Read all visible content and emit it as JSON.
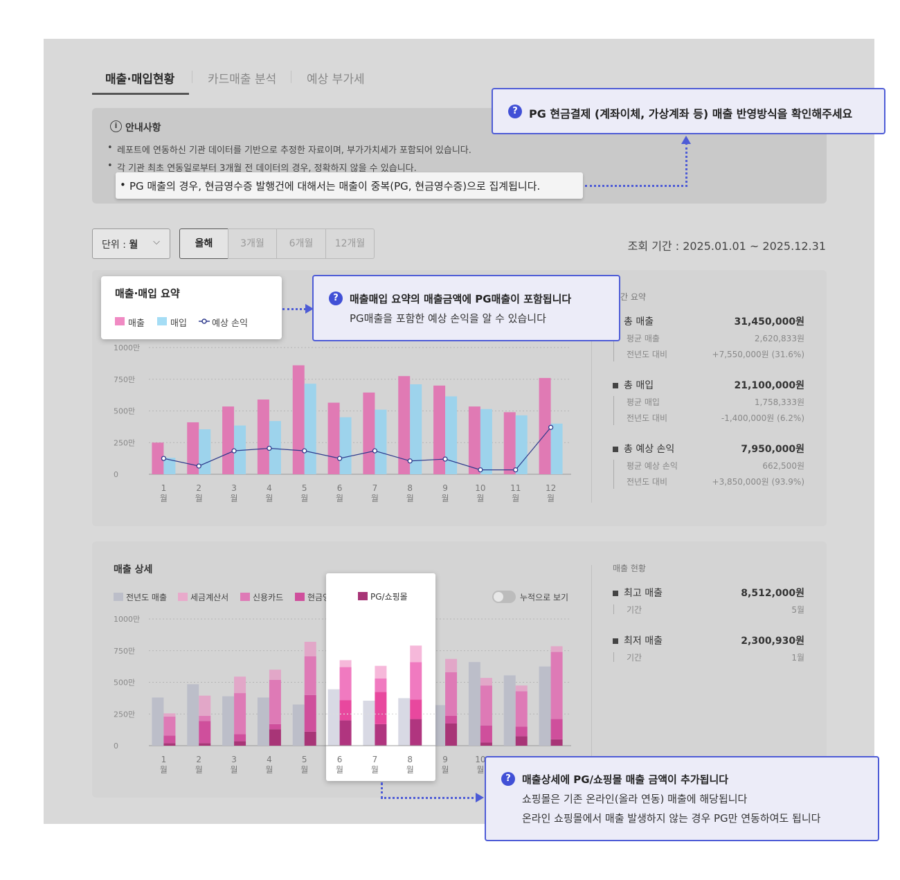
{
  "tabs": [
    {
      "label": "매출·매입현황",
      "active": true
    },
    {
      "label": "카드매출 분석",
      "active": false
    },
    {
      "label": "예상 부가세",
      "active": false
    }
  ],
  "notice": {
    "title": "안내사항",
    "icon": "info-icon",
    "bullets": [
      "레포트에 연동하신 기관 데이터를 기반으로 추정한 자료이며, 부가가치세가 포함되어 있습니다.",
      "각 기관 최초 연동일로부터 3개월 전 데이터의 경우, 정확하지 않을 수 있습니다.",
      "PG 매출의 경우, 현금영수증 발행건에 대해서는 매출이 중복(PG, 현금영수증)으로 집계됩니다."
    ]
  },
  "tooltips": {
    "pg_cash": "PG 현금결제 (계좌이체, 가상계좌 등) 매출 반영방식을 확인해주세요",
    "summary_title": "매출매입 요약의 매출금액에 PG매출이 포함됩니다",
    "summary_desc": "PG매출을 포함한 예상 손익을 알 수 있습니다",
    "detail_title": "매출상세에 PG/쇼핑몰 매출 금액이 추가됩니다",
    "detail_line1": "쇼핑몰은 기존 온라인(올라 연동) 매출에 해당됩니다",
    "detail_line2": "온라인 쇼핑몰에서 매출 발생하지 않는 경우 PG만 연동하여도 됩니다"
  },
  "controls": {
    "unit_label": "단위 : ",
    "unit_value": "월",
    "periods": [
      "올해",
      "3개월",
      "6개월",
      "12개월"
    ],
    "range": "조회 기간 : 2025.01.01 ~ 2025.12.31"
  },
  "summary_panel": {
    "card_title": "매출·매입 요약",
    "legend": [
      "매출",
      "매입",
      "예상 손익"
    ],
    "side_title": "기간 요약",
    "stats": [
      {
        "label": "총 매출",
        "value": "31,450,000원",
        "avg_label": "평균 매출",
        "avg": "2,620,833원",
        "yoy_label": "전년도 대비",
        "yoy": "+7,550,000원 (31.6%)"
      },
      {
        "label": "총 매입",
        "value": "21,100,000원",
        "avg_label": "평균 매입",
        "avg": "1,758,333원",
        "yoy_label": "전년도 대비",
        "yoy": "-1,400,000원 (6.2%)"
      },
      {
        "label": "총 예상 손익",
        "value": "7,950,000원",
        "avg_label": "평균 예상 손익",
        "avg": "662,500원",
        "yoy_label": "전년도 대비",
        "yoy": "+3,850,000원 (93.9%)"
      }
    ]
  },
  "detail_panel": {
    "title": "매출 상세",
    "legend": [
      "전년도 매출",
      "세금계산서",
      "신용카드",
      "현금영수증",
      "PG/쇼핑몰"
    ],
    "toggle_label": "누적으로 보기",
    "side_title": "매출 현황",
    "stats": [
      {
        "label": "최고 매출",
        "value": "8,512,000원",
        "sub_label": "기간",
        "sub": "5월"
      },
      {
        "label": "최저 매출",
        "value": "2,300,930원",
        "sub_label": "기간",
        "sub": "1월"
      }
    ]
  },
  "colors": {
    "sales": "#e07ab4",
    "purchase": "#9dd3ec",
    "profit": "#2e3a8c",
    "prev": "#bcbec9",
    "tax": "#e2a7c8",
    "card": "#de7ab6",
    "cash": "#cf4f9c",
    "pg": "#a83577",
    "accent": "#4150d6"
  },
  "chart_data": [
    {
      "type": "bar",
      "categories": [
        "1월",
        "2월",
        "3월",
        "4월",
        "5월",
        "6월",
        "7월",
        "8월",
        "9월",
        "10월",
        "11월",
        "12월"
      ],
      "y_ticks": [
        "0",
        "250만",
        "500만",
        "750만",
        "1000만"
      ],
      "ylim": [
        0,
        1000
      ],
      "series": [
        {
          "name": "매출",
          "type": "bar",
          "values": [
            250,
            410,
            535,
            590,
            860,
            565,
            645,
            775,
            700,
            535,
            490,
            760
          ]
        },
        {
          "name": "매입",
          "type": "bar",
          "values": [
            130,
            355,
            385,
            420,
            715,
            450,
            510,
            710,
            615,
            515,
            465,
            400
          ]
        },
        {
          "name": "예상 손익",
          "type": "line",
          "values": [
            125,
            65,
            185,
            205,
            185,
            125,
            185,
            105,
            120,
            35,
            35,
            370
          ]
        }
      ]
    },
    {
      "type": "bar",
      "categories": [
        "1월",
        "2월",
        "3월",
        "4월",
        "5월",
        "6월",
        "7월",
        "8월",
        "9월",
        "10월",
        "11월",
        "12월"
      ],
      "y_ticks": [
        "0",
        "250만",
        "500만",
        "750만",
        "1000만"
      ],
      "ylim": [
        0,
        1000
      ],
      "series": [
        {
          "name": "전년도 매출",
          "values": [
            380,
            485,
            390,
            380,
            325,
            445,
            355,
            375,
            320,
            660,
            555,
            625
          ]
        },
        {
          "name": "PG/쇼핑몰",
          "values": [
            20,
            20,
            35,
            130,
            110,
            200,
            170,
            210,
            175,
            25,
            75,
            50
          ]
        },
        {
          "name": "현금영수증",
          "values": [
            60,
            175,
            55,
            40,
            290,
            160,
            255,
            155,
            60,
            135,
            75,
            160
          ]
        },
        {
          "name": "신용카드",
          "values": [
            150,
            40,
            325,
            350,
            305,
            260,
            105,
            295,
            345,
            315,
            280,
            530
          ]
        },
        {
          "name": "세금계산서",
          "values": [
            25,
            160,
            130,
            80,
            115,
            55,
            100,
            130,
            105,
            60,
            45,
            45
          ]
        }
      ]
    }
  ]
}
